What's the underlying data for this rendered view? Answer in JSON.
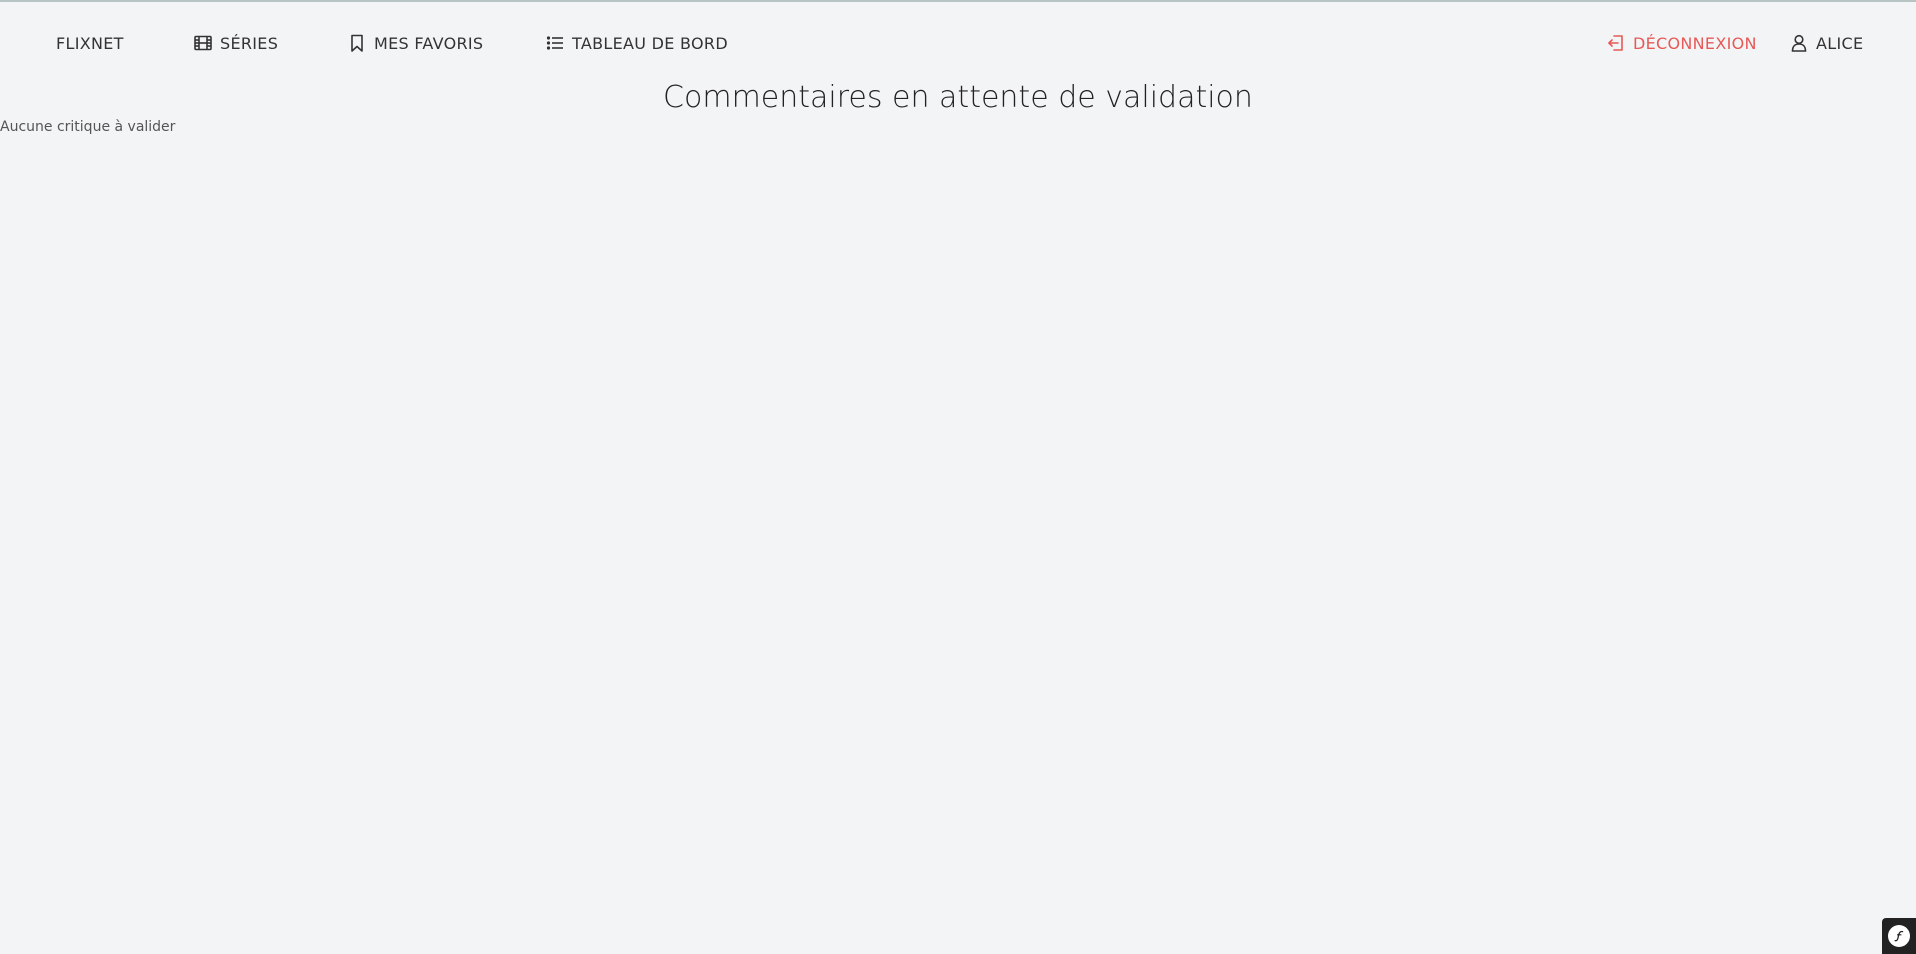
{
  "nav": {
    "brand": "FLIXNET",
    "series": "SÉRIES",
    "favoris": "MES FAVORIS",
    "dashboard": "TABLEAU DE BORD",
    "logout": "DÉCONNEXION",
    "user": "ALICE"
  },
  "icons": {
    "series": "film-icon",
    "favoris": "bookmark-icon",
    "dashboard": "list-icon",
    "logout": "logout-icon",
    "user": "user-icon",
    "symfony": "symfony-icon"
  },
  "colors": {
    "background": "#f3f4f6",
    "text": "#333333",
    "logout": "#e55a57",
    "toolbar": "#222222"
  },
  "main": {
    "title": "Commentaires en attente de validation",
    "empty_message": "Aucune critique à valider"
  }
}
